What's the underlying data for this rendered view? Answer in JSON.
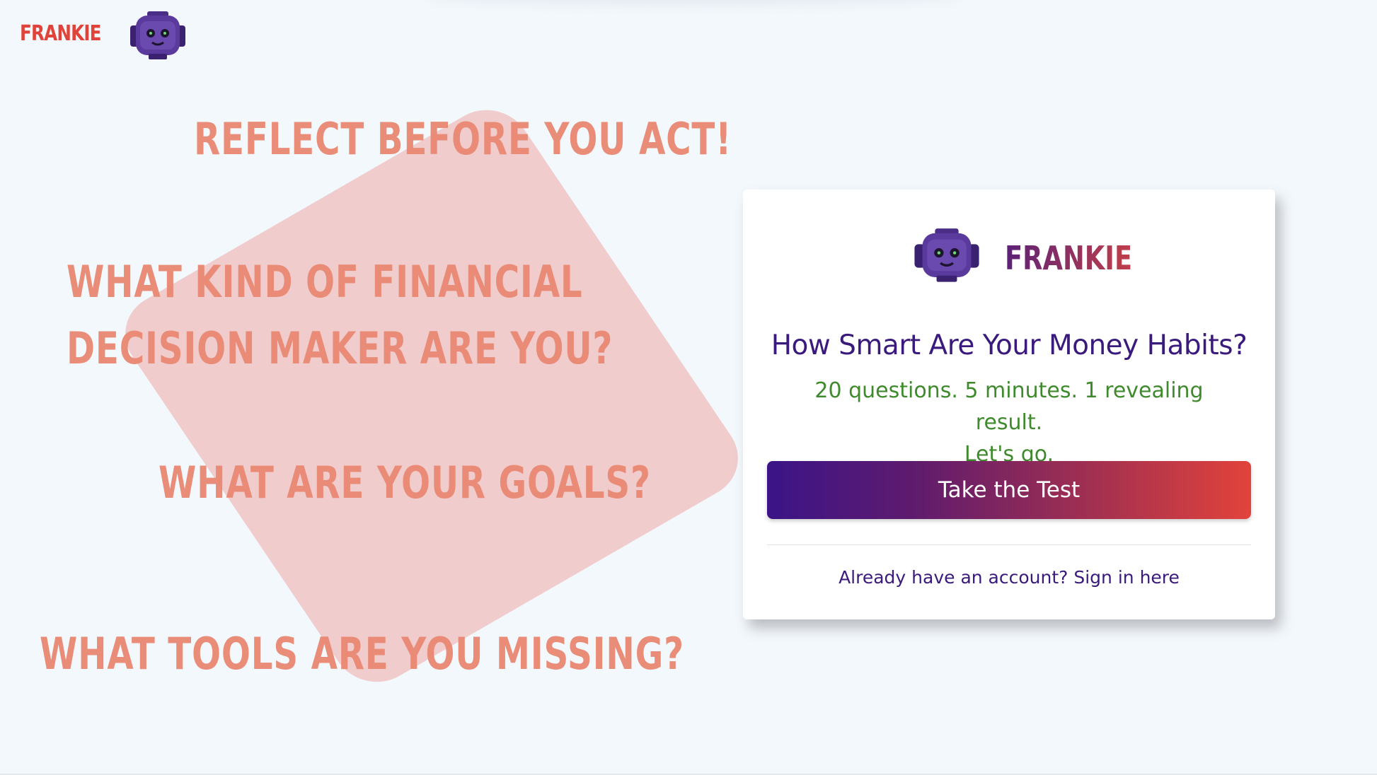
{
  "header": {
    "brand_text": "FRANKIE",
    "logo_icon": "robot-icon",
    "brand_color": "#e0433a"
  },
  "headlines": {
    "reflect": "REFLECT BEFORE YOU ACT!",
    "decision_line1": "WHAT KIND OF FINANCIAL",
    "decision_line2": "DECISION MAKER ARE YOU?",
    "goals": "WHAT ARE YOUR GOALS?",
    "tools": "WHAT TOOLS ARE YOU MISSING?",
    "color": "#e98872"
  },
  "card": {
    "brand_text": "FRANKIE",
    "logo_icon": "robot-icon",
    "title": "How Smart Are Your Money Habits?",
    "subtitle_line1": "20 questions. 5 minutes. 1 revealing result.",
    "subtitle_line2": "Let's go.",
    "cta_label": "Take the Test",
    "signin_text": "Already have an account? Sign in here",
    "title_color": "#3a1a7c",
    "subtitle_color": "#3f8a2d",
    "cta_gradient": [
      "#3b1487",
      "#e2433b"
    ]
  }
}
